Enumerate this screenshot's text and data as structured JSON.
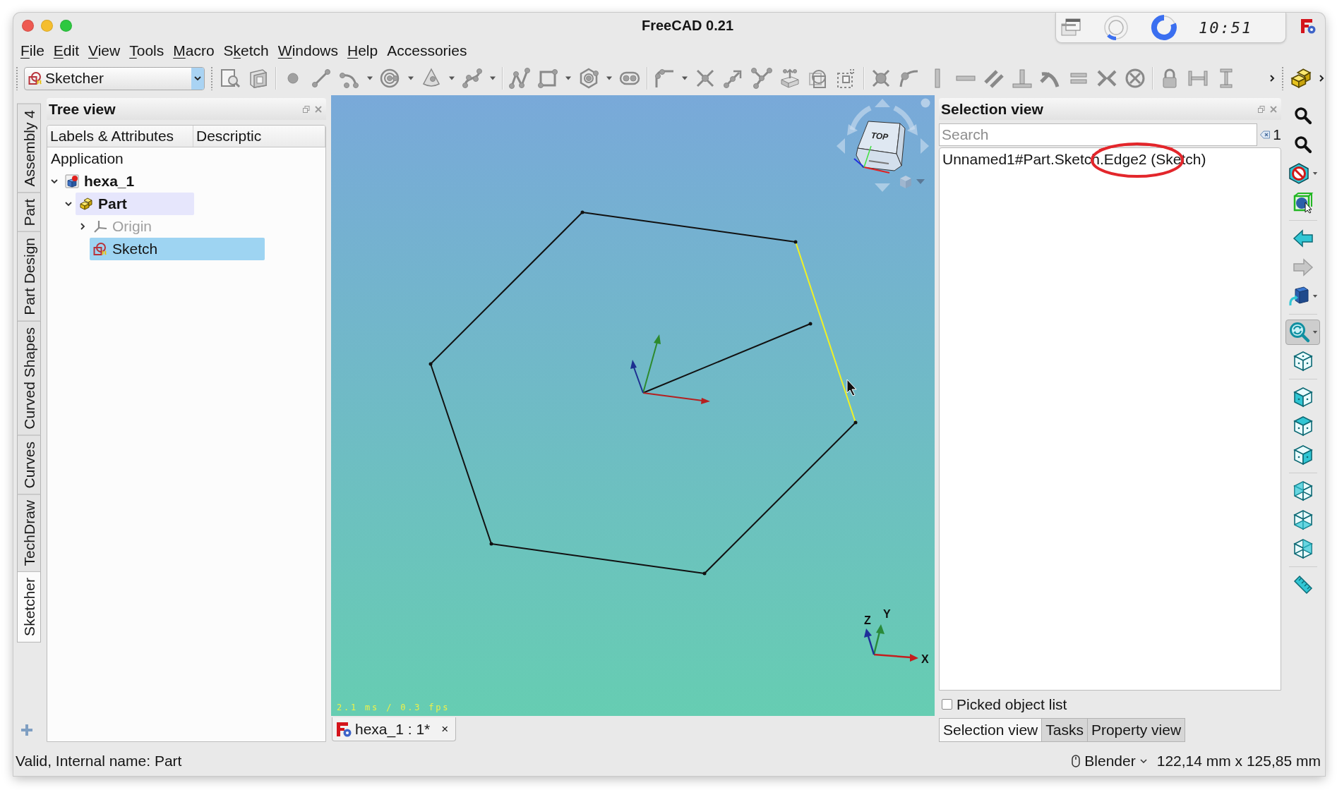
{
  "window": {
    "title": "FreeCAD 0.21"
  },
  "tray": {
    "clock": "10:51"
  },
  "menu": [
    {
      "key": "F",
      "rest": "ile"
    },
    {
      "key": "E",
      "rest": "dit"
    },
    {
      "key": "V",
      "rest": "iew"
    },
    {
      "key": "T",
      "rest": "ools"
    },
    {
      "key": "M",
      "rest": "acro"
    },
    {
      "lead": "S",
      "key": "k",
      "rest": "etch"
    },
    {
      "key": "W",
      "rest": "indows"
    },
    {
      "key": "H",
      "rest": "elp"
    },
    {
      "rest": "Accessories"
    }
  ],
  "toolbar": {
    "workbench": "Sketcher",
    "sketch_tools": {
      "disabled": true
    }
  },
  "view_toolbar": [
    {
      "disabled": false,
      "pressed": false
    },
    {
      "disabled": false,
      "pressed": false
    },
    {
      "disabled": false,
      "pressed": false
    },
    {
      "disabled": false,
      "pressed": false
    },
    {
      "disabled": false,
      "pressed": false
    },
    {
      "disabled": true,
      "pressed": false
    },
    {
      "disabled": false,
      "pressed": false
    },
    {
      "disabled": false,
      "pressed": true
    },
    {
      "disabled": false,
      "pressed": false
    },
    {
      "disabled": false,
      "pressed": false
    },
    {
      "disabled": false,
      "pressed": false
    },
    {
      "disabled": false,
      "pressed": false
    },
    {
      "disabled": false,
      "pressed": false
    },
    {
      "disabled": false,
      "pressed": false
    },
    {
      "disabled": false,
      "pressed": false
    },
    {
      "disabled": false,
      "pressed": false
    }
  ],
  "workbench_tabs": [
    {
      "label": "Assembly 4",
      "selected": false
    },
    {
      "label": "Part",
      "selected": false
    },
    {
      "label": "Part Design",
      "selected": false
    },
    {
      "label": "Curved Shapes",
      "selected": false
    },
    {
      "label": "Curves",
      "selected": false
    },
    {
      "label": "TechDraw",
      "selected": false
    },
    {
      "label": "Sketcher",
      "selected": true
    }
  ],
  "tree_view": {
    "title": "Tree view",
    "columns": [
      "Labels & Attributes",
      "Descriptic"
    ],
    "items": [
      {
        "label": "Application",
        "selected": false,
        "active": false,
        "highlighted": false,
        "visible": true,
        "children": [
          {
            "label": "hexa_1",
            "kind": "document",
            "expanded": true,
            "selected": false,
            "active": true,
            "highlighted": false,
            "visible": true,
            "children": [
              {
                "label": "Part",
                "kind": "part",
                "expanded": true,
                "selected": false,
                "active": true,
                "highlighted": true,
                "visible": true,
                "children": [
                  {
                    "label": "Origin",
                    "kind": "origin",
                    "expanded": false,
                    "selected": false,
                    "active": false,
                    "highlighted": false,
                    "visible": false
                  },
                  {
                    "label": "Sketch",
                    "kind": "sketch",
                    "selected": true,
                    "active": false,
                    "highlighted": false,
                    "visible": true
                  }
                ]
              }
            ]
          }
        ]
      }
    ]
  },
  "viewport": {
    "nav_cube_face": "TOP",
    "axis_labels": {
      "x": "X",
      "y": "Y",
      "z": "Z"
    },
    "sketch_edges": [
      {
        "selected": false
      },
      {
        "selected": true
      },
      {
        "selected": false
      },
      {
        "selected": false
      },
      {
        "selected": false
      },
      {
        "selected": false
      }
    ],
    "fps": "2.1 ms / 0.3 fps"
  },
  "document_tab": {
    "label": "hexa_1 : 1*",
    "close": "×"
  },
  "selection_view": {
    "title": "Selection view",
    "search": {
      "placeholder": "Search"
    },
    "count": "1",
    "items": [
      "Unnamed1#Part.Sketch.Edge2 (Sketch)"
    ],
    "picked_object_list": {
      "label": "Picked object list",
      "checked": false
    }
  },
  "panel_tabs": [
    {
      "label": "Selection view",
      "selected": true
    },
    {
      "label": "Tasks",
      "selected": false
    },
    {
      "label": "Property view",
      "selected": false
    }
  ],
  "status_bar": {
    "message": "Valid, Internal name: Part",
    "navigation": "Blender",
    "dimensions": "122,14 mm x 125,85 mm"
  }
}
